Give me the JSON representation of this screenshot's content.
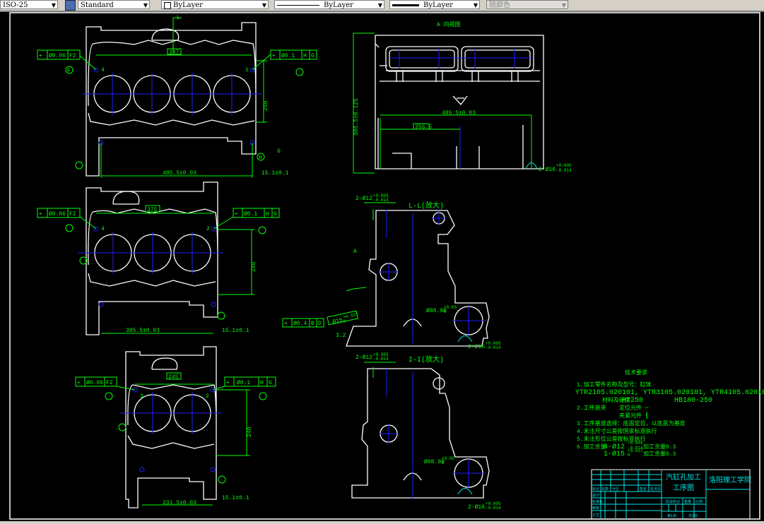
{
  "toolbar": {
    "dimstyle": "ISO-25",
    "textstyle": "Standard",
    "layer_color": "ByLayer",
    "linetype": "ByLayer",
    "lineweight": "ByLayer",
    "plotstyle": "随颜色"
  },
  "colors": {
    "background": "#000000",
    "geometry": "#ffffff",
    "annotation": "#00ff00",
    "centerline": "#2020ff",
    "title_block": "#00e5e5"
  },
  "view1": {
    "fcf_left": [
      "⌖",
      "Ø0.06",
      "F2"
    ],
    "fcf_right": [
      "⌖",
      "Ø0.1",
      "H",
      "G"
    ],
    "datum_f": "F",
    "datum_h": "H",
    "datum_g": "G",
    "datum_l": "L",
    "dim_top": "307",
    "dim_width": "485.5±0.03",
    "dim_offset": "15.1±0.1",
    "dim_height": "240",
    "hole_left": "4",
    "hole_right": "1"
  },
  "view2": {
    "fcf_left": [
      "⌖",
      "Ø0.06",
      "F2"
    ],
    "fcf_right": [
      "⌖",
      "Ø0.1",
      "H",
      "G"
    ],
    "dim_top": "375",
    "dim_width": "385.5±0.03",
    "dim_offset": "15.1±0.1",
    "dim_height": "240",
    "hole_left": "4",
    "hole_right": "2"
  },
  "view3": {
    "fcf_left": [
      "⌖",
      "Ø0.06",
      "F2"
    ],
    "fcf_right": [
      "⌖",
      "Ø0.1",
      "H",
      "G"
    ],
    "dim_top": "245",
    "dim_width": "231.5±0.03",
    "dim_offset": "15.1±0.1",
    "dim_height": "240",
    "hole_left": "3",
    "hole_right": "2"
  },
  "side_view": {
    "title": "A 向视图",
    "dim_height": "386.5±0.125",
    "dim_length": "485.5±0.03",
    "dim_half": "256.5",
    "dim_hole": "2-Ø16",
    "tol_hole": [
      "+0.005",
      "-0.014"
    ]
  },
  "section_ll": {
    "title": "L-L(放大)",
    "arrow_a": "A",
    "dim_hole_top": "2-Ø12",
    "tol_hole_top": [
      "+0.005",
      "-0.014"
    ],
    "dim_bore": "Ø88.98",
    "tol_bore": [
      "+0.05",
      "0"
    ],
    "dim_15": "Ø15",
    "tol_15": [
      "+0.027",
      "0"
    ],
    "fcf": [
      "⌖",
      "Ø0.4",
      "B",
      "D"
    ],
    "dim_hole_bottom": "2-Ø16",
    "tol_hole_bottom": [
      "+0.005",
      "-0.014"
    ],
    "rough": "3.2"
  },
  "section_ii": {
    "title": "I-I(放大)",
    "dim_hole_top": "2-Ø12",
    "tol_hole_top": [
      "+0.005",
      "-0.014"
    ],
    "dim_bore": "Ø88.98",
    "tol_bore": [
      "+0.05",
      "0"
    ],
    "dim_hole_bottom": "2-Ø16",
    "tol_hole_bottom": [
      "+0.005",
      "-0.014"
    ]
  },
  "tech": {
    "title": "技术要求",
    "l1": "1.加工零件名称及型号：缸体",
    "l1b": "YTR2105.020101, YTR3105.020101, YTR4105.020101",
    "l1c_label": "材料及硬度",
    "l1c_mat": "HT250",
    "l1c_hb": "HB180-250",
    "l2": "2.工件装夹",
    "l2a": "定位元件 ⌒",
    "l2b": "夹紧元件 ┃",
    "l3": "3.工序基准选择：底面定位，以底面为基准",
    "l4": "4.未注尺寸公差按国家标准执行",
    "l5": "5.未注形位公差按标准执行",
    "l6": "6.加工余量",
    "l6a": "4-Ø12",
    "l6a_tol": [
      "+0.005",
      "-0.014"
    ],
    "l6a_allow": "加工余量0.3",
    "l6b": "1-Ø15",
    "l6b_tol": [
      "+0.027",
      "0"
    ],
    "l6b_allow": "加工余量0.3"
  },
  "title_block": {
    "drawing_name_1": "汽缸孔加工",
    "drawing_name_2": "工序图",
    "school": "洛阳理工学院",
    "headers": [
      "标记",
      "处数",
      "分区",
      "签名",
      "年月日"
    ],
    "roles": [
      "设计",
      "标准化",
      "审核",
      "工艺"
    ],
    "stage": "阶段标记",
    "weight": "重量",
    "scale": "比例",
    "sheet": "第1张",
    "total": "共1张"
  }
}
